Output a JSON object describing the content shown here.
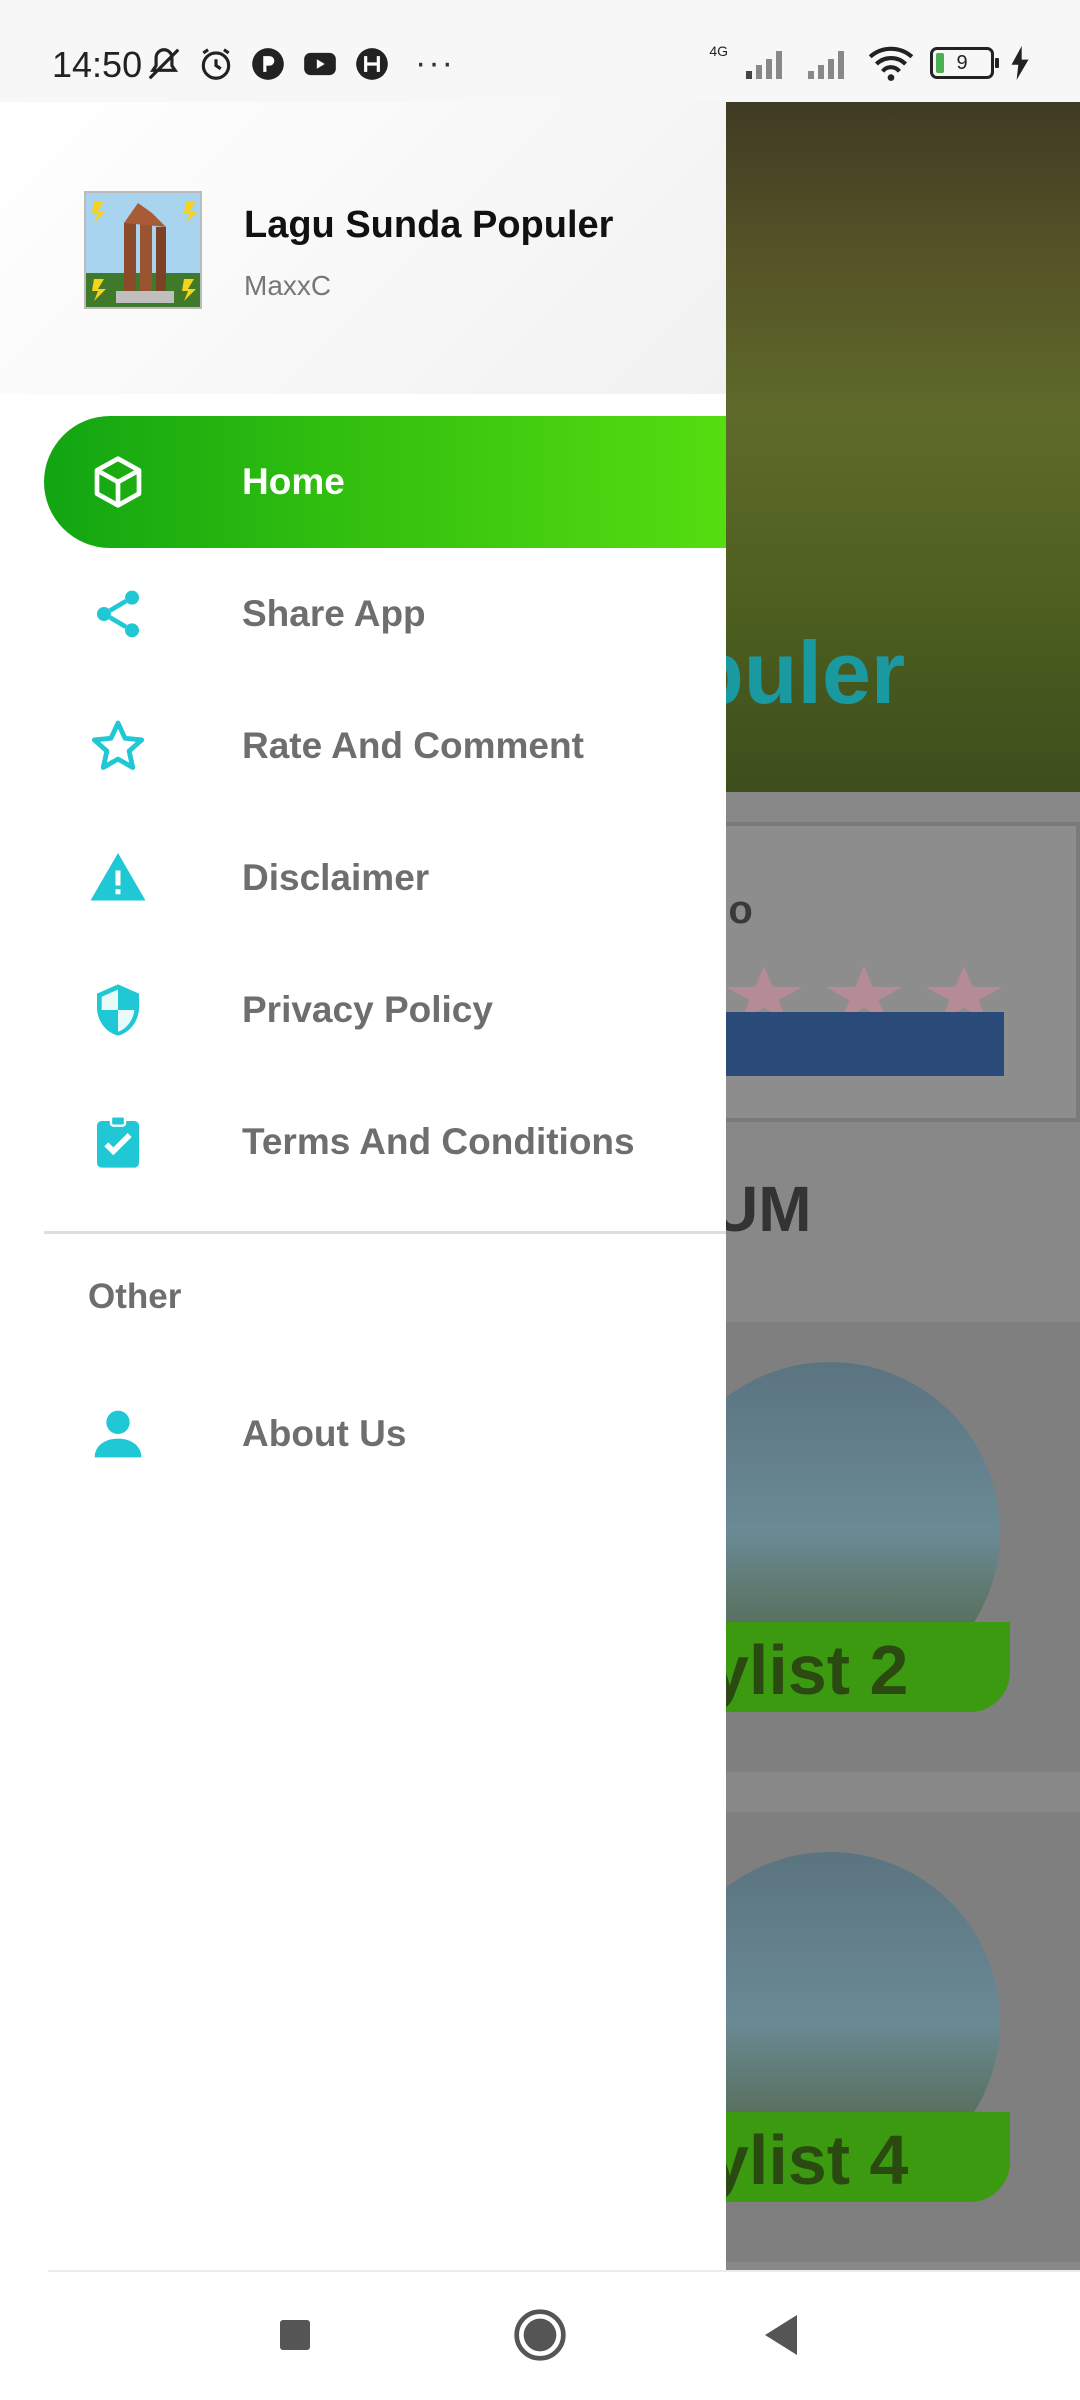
{
  "status_bar": {
    "time": "14:50",
    "network": "4G",
    "battery_level": "9",
    "icons": [
      "mute-icon",
      "alarm-icon",
      "app-icon",
      "youtube-icon",
      "h-icon",
      "more-dots-icon",
      "signal-icon",
      "wifi-icon",
      "battery-icon",
      "charging-icon"
    ]
  },
  "drawer": {
    "app_title": "Lagu Sunda Populer",
    "app_subtitle": "MaxxC",
    "items": [
      {
        "label": "Home",
        "icon": "cube-icon",
        "active": true
      },
      {
        "label": "Share App",
        "icon": "share-icon"
      },
      {
        "label": "Rate And Comment",
        "icon": "star-icon"
      },
      {
        "label": "Disclaimer",
        "icon": "warning-icon"
      },
      {
        "label": "Privacy Policy",
        "icon": "shield-icon"
      },
      {
        "label": "Terms And Conditions",
        "icon": "clipboard-check-icon"
      }
    ],
    "section_label": "Other",
    "other_items": [
      {
        "label": "About Us",
        "icon": "person-icon"
      }
    ],
    "colors": {
      "accent_gradient_start": "#12a512",
      "accent_gradient_end": "#56dd10",
      "icon_color": "#1fc8d4",
      "label_color": "#6e6e6e"
    }
  },
  "background": {
    "banner_title_fragment": "puler",
    "card_text_fragment": "go",
    "section_title_fragment": "UM",
    "tiles": [
      "ylist 2",
      "ylist 4"
    ]
  },
  "nav_bar": {
    "buttons": [
      "recents-button",
      "home-button",
      "back-button"
    ]
  }
}
